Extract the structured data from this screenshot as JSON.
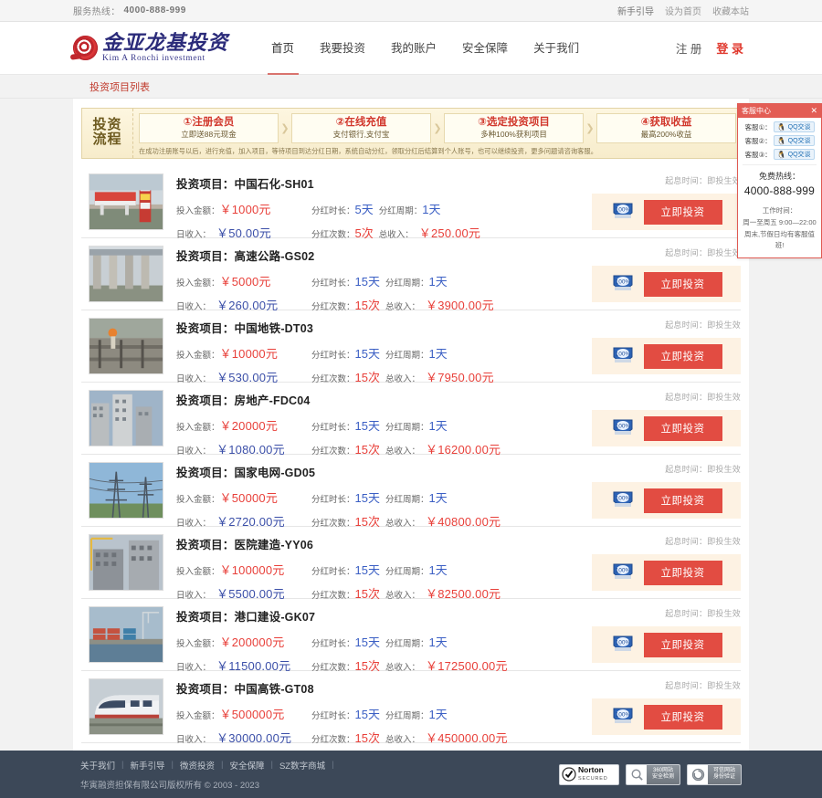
{
  "topbar": {
    "service_label": "服务热线：",
    "phone": "4000-888-999",
    "links": [
      "新手引导",
      "设为首页",
      "收藏本站"
    ]
  },
  "header": {
    "logo_cn": "金亚龙基投资",
    "logo_en": "Kim A Ronchi investment",
    "nav": [
      {
        "label": "首页",
        "active": true
      },
      {
        "label": "我要投资",
        "active": false
      },
      {
        "label": "我的账户",
        "active": false
      },
      {
        "label": "安全保障",
        "active": false
      },
      {
        "label": "关于我们",
        "active": false
      }
    ],
    "register": "注 册",
    "login": "登 录"
  },
  "breadcrumb": "投资项目列表",
  "flow": {
    "label_line1": "投资",
    "label_line2": "流程",
    "steps": [
      {
        "title": "①注册会员",
        "sub": "立即送88元现金"
      },
      {
        "title": "②在线充值",
        "sub": "支付银行,支付宝"
      },
      {
        "title": "③选定投资项目",
        "sub": "多种100%获利项目"
      },
      {
        "title": "④获取收益",
        "sub": "最高200%收益"
      }
    ],
    "arrow": "❯",
    "note": "在成功注册账号以后，进行充值，加入项目，等待项目到达分红日期，系统自动分红，领取分红后结算到个人账号，也可以继续投资，更多问题请咨询客服。"
  },
  "labels": {
    "project_prefix": "投资项目：",
    "amount": "投入金额：",
    "duration": "分红时长：",
    "period": "分红周期：",
    "daily": "日收入：",
    "times": "分红次数：",
    "total": "总收入：",
    "start_time": "起息时间：即投生效",
    "invest_button": "立即投资",
    "shield_text": "100%"
  },
  "projects": [
    {
      "name": "中国石化-SH01",
      "amount": "￥1000元",
      "duration": "5天",
      "period": "1天",
      "daily": "￥50.00元",
      "times": "5次",
      "total": "￥250.00元",
      "thumb": "gas-station"
    },
    {
      "name": "高速公路-GS02",
      "amount": "￥5000元",
      "duration": "15天",
      "period": "1天",
      "daily": "￥260.00元",
      "times": "15次",
      "total": "￥3900.00元",
      "thumb": "highway"
    },
    {
      "name": "中国地铁-DT03",
      "amount": "￥10000元",
      "duration": "15天",
      "period": "1天",
      "daily": "￥530.00元",
      "times": "15次",
      "total": "￥7950.00元",
      "thumb": "subway"
    },
    {
      "name": "房地产-FDC04",
      "amount": "￥20000元",
      "duration": "15天",
      "period": "1天",
      "daily": "￥1080.00元",
      "times": "15次",
      "total": "￥16200.00元",
      "thumb": "realestate"
    },
    {
      "name": "国家电网-GD05",
      "amount": "￥50000元",
      "duration": "15天",
      "period": "1天",
      "daily": "￥2720.00元",
      "times": "15次",
      "total": "￥40800.00元",
      "thumb": "powergrid"
    },
    {
      "name": "医院建造-YY06",
      "amount": "￥100000元",
      "duration": "15天",
      "period": "1天",
      "daily": "￥5500.00元",
      "times": "15次",
      "total": "￥82500.00元",
      "thumb": "hospital"
    },
    {
      "name": "港口建设-GK07",
      "amount": "￥200000元",
      "duration": "15天",
      "period": "1天",
      "daily": "￥11500.00元",
      "times": "15次",
      "total": "￥172500.00元",
      "thumb": "port"
    },
    {
      "name": "中国高铁-GT08",
      "amount": "￥500000元",
      "duration": "15天",
      "period": "1天",
      "daily": "￥30000.00元",
      "times": "15次",
      "total": "￥450000.00元",
      "thumb": "train"
    }
  ],
  "service": {
    "title": "客服中心",
    "close": "✕",
    "agents": [
      {
        "label": "客服①：",
        "btn": "QQ交谈"
      },
      {
        "label": "客服②：",
        "btn": "QQ交谈"
      },
      {
        "label": "客服③：",
        "btn": "QQ交谈"
      }
    ],
    "hotline_label": "免费热线：",
    "hotline": "4000-888-999",
    "worktime_label": "工作时间：",
    "worktime_1": "周一至周五 9:00—22:00",
    "worktime_2": "周末,节假日均有客服值班!"
  },
  "footer": {
    "links": [
      "关于我们",
      "新手引导",
      "微资投资",
      "安全保障",
      "SZ数字商城"
    ],
    "separator": "|",
    "copyright": "华寅融资担保有限公司版权所有 © 2003 - 2023",
    "badges": [
      {
        "name": "Norton",
        "sub": "SECURED"
      },
      {
        "name": "360网站",
        "sub": "安全检测"
      },
      {
        "name": "可信网站",
        "sub": "身份验证"
      }
    ]
  },
  "colors": {
    "accent_red": "#e24c42",
    "brand_blue": "#2b2b7a",
    "footer_bg": "#3c4858"
  }
}
